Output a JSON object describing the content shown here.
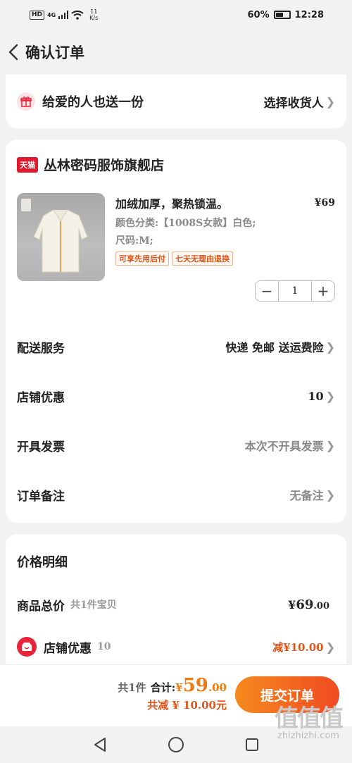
{
  "status": {
    "hd": "HD",
    "signal": "4G",
    "speed_value": "11",
    "speed_unit": "K/s",
    "battery": "60%",
    "battery_level": 0.6,
    "time": "12:28"
  },
  "header": {
    "title": "确认订单"
  },
  "gift": {
    "label": "给爱的人也送一份",
    "action": "选择收货人"
  },
  "store": {
    "badge": "天猫",
    "name": "丛林密码服饰旗舰店"
  },
  "product": {
    "title": "加绒加厚，聚热锁温。",
    "price": "¥69",
    "spec_color": "颜色分类:【1008S女款】白色;",
    "spec_size": "尺码:M;",
    "tags": [
      "可享先用后付",
      "七天无理由退换"
    ],
    "quantity": "1",
    "minus": "−",
    "plus": "+"
  },
  "options": {
    "delivery": {
      "label": "配送服务",
      "value": "快递 免邮 送运费险"
    },
    "shop_discount": {
      "label": "店铺优惠",
      "value": "10"
    },
    "invoice": {
      "label": "开具发票",
      "value": "本次不开具发票"
    },
    "remark": {
      "label": "订单备注",
      "value": "无备注"
    }
  },
  "price_detail": {
    "heading": "价格明细",
    "goods_label": "商品总价",
    "goods_sub": "共1件宝贝",
    "goods_total_symbol": "¥",
    "goods_total_int": "69",
    "goods_total_dec": ".00",
    "shop_label": "店铺优惠",
    "shop_sub": "10",
    "shop_value": "减¥10.00"
  },
  "bottom": {
    "count": "共1件",
    "total_label": "合计:",
    "total_symbol": "¥",
    "total_int": "59",
    "total_dec": ".00",
    "saved": "共减 ¥ 10.00元",
    "submit": "提交订单"
  },
  "watermark": {
    "logo": "值值值",
    "site": "zhizhizhi.com"
  },
  "colors": {
    "accent": "#f04a22",
    "orange": "#f07a10",
    "tmall_red": "#e0192d"
  }
}
